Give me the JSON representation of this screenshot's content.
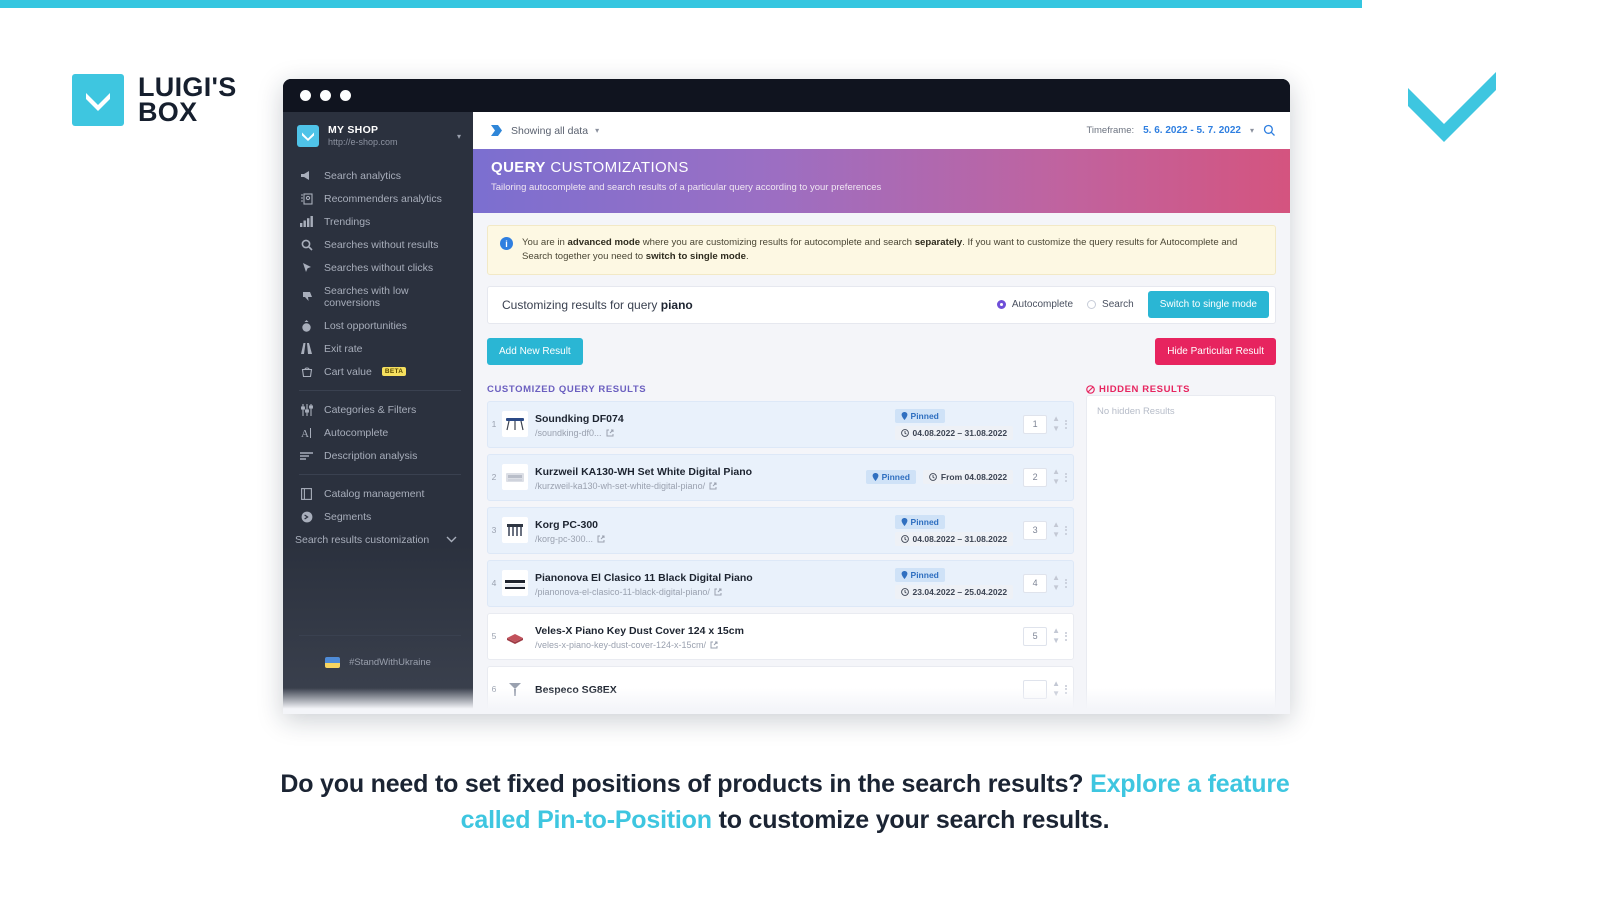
{
  "brand": {
    "line1": "LUIGI'S",
    "line2": "BOX"
  },
  "sidebar": {
    "shop": {
      "name": "MY SHOP",
      "url": "http://e-shop.com"
    },
    "groups": [
      {
        "items": [
          {
            "label": "Search analytics",
            "icon": "megaphone-icon"
          },
          {
            "label": "Recommenders analytics",
            "icon": "report-icon"
          },
          {
            "label": "Trendings",
            "icon": "bar-chart-icon"
          },
          {
            "label": "Searches without results",
            "icon": "magnifier-icon"
          },
          {
            "label": "Searches without clicks",
            "icon": "cursor-icon"
          },
          {
            "label": "Searches with low conversions",
            "icon": "thumb-down-icon"
          },
          {
            "label": "Lost opportunities",
            "icon": "money-bag-icon"
          },
          {
            "label": "Exit rate",
            "icon": "exit-road-icon"
          },
          {
            "label": "Cart value",
            "icon": "cart-icon",
            "badge": "BETA"
          }
        ]
      },
      {
        "items": [
          {
            "label": "Categories & Filters",
            "icon": "sliders-icon"
          },
          {
            "label": "Autocomplete",
            "icon": "text-cursor-icon"
          },
          {
            "label": "Description analysis",
            "icon": "lines-icon"
          }
        ]
      },
      {
        "items": [
          {
            "label": "Catalog management",
            "icon": "book-icon"
          },
          {
            "label": "Segments",
            "icon": "segment-icon"
          }
        ]
      }
    ],
    "collapsible": {
      "label": "Search results customization",
      "icon": "chevron-down-icon"
    },
    "ukraine": {
      "label": "#StandWithUkraine",
      "flag_top": "#4f8bd6",
      "flag_bottom": "#f7d560"
    }
  },
  "appbar": {
    "showing_label": "Showing all data",
    "timeframe_label": "Timeframe:",
    "timeframe_value": "5. 6. 2022 - 5. 7. 2022",
    "search_icon": "search-icon"
  },
  "pagehead": {
    "title_bold": "QUERY",
    "title_rest": " CUSTOMIZATIONS",
    "subtitle": "Tailoring autocomplete and search results of a particular query according to your preferences"
  },
  "banner": {
    "icon": "info-icon",
    "text_1": "You are in ",
    "bold_1": "advanced mode",
    "text_2": " where you are customizing results for autocomplete and search ",
    "bold_2": "separately",
    "text_3": ". If you want to customize the query results for Autocomplete and Search together you need to ",
    "bold_3": "switch to single mode",
    "text_4": "."
  },
  "custbar": {
    "title_prefix": "Customizing results for query ",
    "query": "piano",
    "radio_autocomplete": "Autocomplete",
    "radio_search": "Search",
    "switch_button": "Switch to single mode",
    "selected_mode": "Autocomplete"
  },
  "actions": {
    "add_new_result": "Add New Result",
    "hide_particular_result": "Hide Particular Result",
    "customized_label": "CUSTOMIZED QUERY RESULTS",
    "hidden_label": "HIDDEN RESULTS",
    "hidden_empty": "No hidden Results"
  },
  "results": [
    {
      "index": "1",
      "title": "Soundking DF074",
      "url": "/soundking-df0...",
      "pinned": true,
      "pinned_label": "Pinned",
      "date": "04.08.2022 – 31.08.2022",
      "position": "1",
      "layout": "stacked",
      "thumb": "stand-icon"
    },
    {
      "index": "2",
      "title": "Kurzweil KA130-WH Set White Digital Piano",
      "url": "/kurzweil-ka130-wh-set-white-digital-piano/",
      "pinned": true,
      "pinned_label": "Pinned",
      "date": "From 04.08.2022",
      "position": "2",
      "layout": "inline",
      "thumb": "piano-icon"
    },
    {
      "index": "3",
      "title": "Korg PC-300",
      "url": "/korg-pc-300...",
      "pinned": true,
      "pinned_label": "Pinned",
      "date": "04.08.2022 – 31.08.2022",
      "position": "3",
      "layout": "stacked",
      "thumb": "keyboard-icon"
    },
    {
      "index": "4",
      "title": "Pianonova El Clasico 11 Black Digital Piano",
      "url": "/pianonova-el-clasico-11-black-digital-piano/",
      "pinned": true,
      "pinned_label": "Pinned",
      "date": "23.04.2022 – 25.04.2022",
      "position": "4",
      "layout": "stacked",
      "thumb": "black-piano-icon"
    },
    {
      "index": "5",
      "title": "Veles-X Piano Key Dust Cover 124 x 15cm",
      "url": "/veles-x-piano-key-dust-cover-124-x-15cm/",
      "pinned": false,
      "pinned_label": "",
      "date": "",
      "position": "5",
      "layout": "none",
      "thumb": "cover-icon"
    },
    {
      "index": "6",
      "title": "Bespeco SG8EX",
      "url": "",
      "pinned": false,
      "pinned_label": "",
      "date": "",
      "position": "",
      "layout": "none",
      "thumb": "mic-icon"
    }
  ],
  "caption": {
    "part1": "Do you need to set fixed positions of products in the search results? ",
    "link1": "Explore a feature called Pin-to-Position",
    "part2": " to customize your search results."
  },
  "colors": {
    "cyan": "#3ec6e0",
    "pink": "#e7245f",
    "purple": "#6f4fd8",
    "sidebar": "#2b313e",
    "blue": "#2f7fe0"
  }
}
